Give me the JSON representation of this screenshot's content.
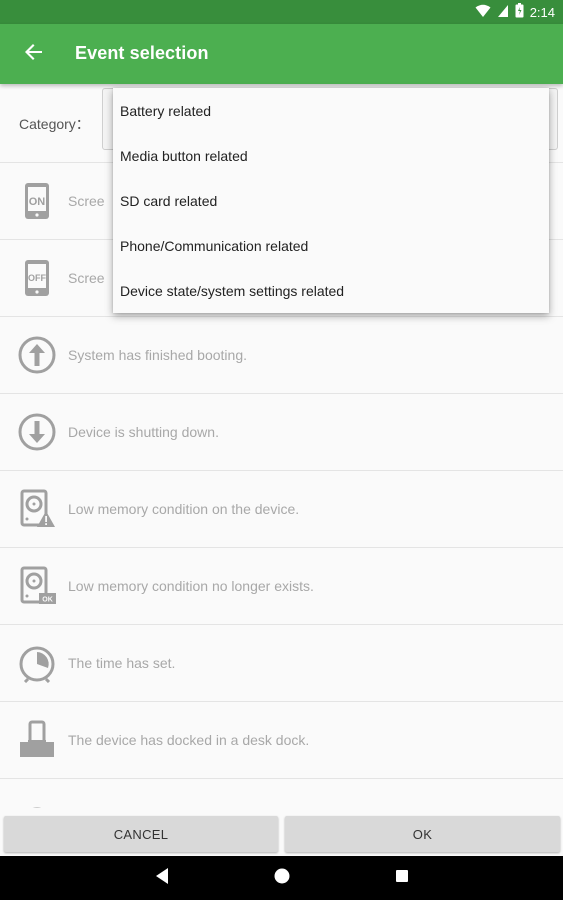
{
  "status_bar": {
    "time": "2:14",
    "icons": [
      "wifi-icon",
      "signal-icon",
      "battery-icon"
    ]
  },
  "app_bar": {
    "title": "Event selection",
    "back_icon": "arrow-back-icon"
  },
  "category": {
    "label": "Category："
  },
  "dropdown": {
    "options": [
      "Battery related",
      "Media button related",
      "SD card related",
      "Phone/Communication related",
      "Device state/system settings related"
    ]
  },
  "events": [
    {
      "icon": "screen-on-icon",
      "text": "Scree"
    },
    {
      "icon": "screen-off-icon",
      "text": "Scree"
    },
    {
      "icon": "boot-up-icon",
      "text": "System has finished booting."
    },
    {
      "icon": "shutdown-icon",
      "text": "Device is shutting down."
    },
    {
      "icon": "low-memory-icon",
      "text": "Low memory condition on the device."
    },
    {
      "icon": "memory-ok-icon",
      "text": "Low memory condition no longer exists."
    },
    {
      "icon": "clock-icon",
      "text": "The time has set."
    },
    {
      "icon": "desk-dock-icon",
      "text": "The device has docked in a desk dock."
    },
    {
      "icon": "partial-icon",
      "text": ""
    }
  ],
  "buttons": {
    "cancel": "CANCEL",
    "ok": "OK"
  },
  "colors": {
    "status_bar": "#388e3c",
    "app_bar": "#4caf50",
    "icon_gray": "#9e9e9e"
  }
}
